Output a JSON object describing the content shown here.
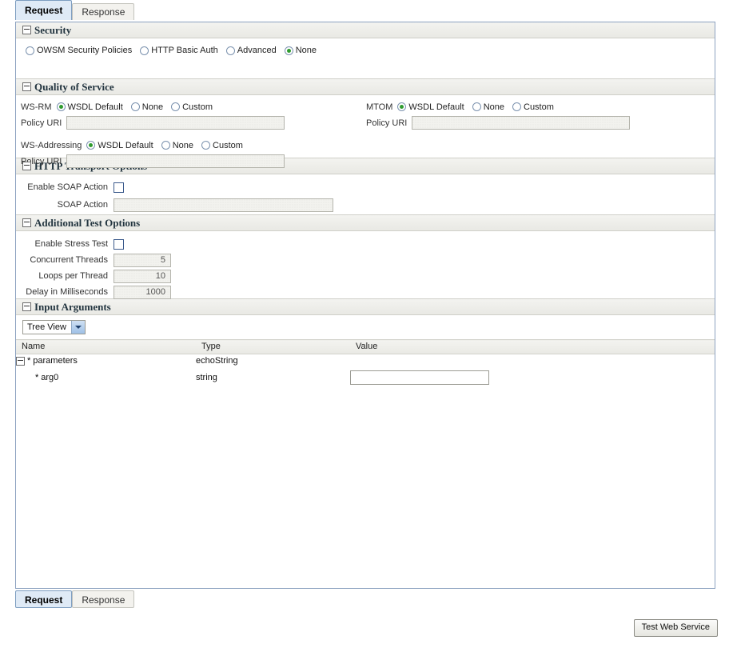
{
  "tabs_top": [
    {
      "label": "Request",
      "active": true
    },
    {
      "label": "Response",
      "active": false
    }
  ],
  "tabs_bottom": [
    {
      "label": "Request",
      "active": true
    },
    {
      "label": "Response",
      "active": false
    }
  ],
  "sections": {
    "security": {
      "title": "Security",
      "options": [
        {
          "label": "OWSM Security Policies",
          "selected": false
        },
        {
          "label": "HTTP Basic Auth",
          "selected": false
        },
        {
          "label": "Advanced",
          "selected": false
        },
        {
          "label": "None",
          "selected": true
        }
      ]
    },
    "qos": {
      "title": "Quality of Service",
      "wsrm": {
        "caption": "WS-RM",
        "options": [
          {
            "label": "WSDL Default",
            "selected": true
          },
          {
            "label": "None",
            "selected": false
          },
          {
            "label": "Custom",
            "selected": false
          }
        ],
        "policy_uri_label": "Policy URI",
        "policy_uri_value": "",
        "policy_uri_enabled": false
      },
      "mtom": {
        "caption": "MTOM",
        "options": [
          {
            "label": "WSDL Default",
            "selected": true
          },
          {
            "label": "None",
            "selected": false
          },
          {
            "label": "Custom",
            "selected": false
          }
        ],
        "policy_uri_label": "Policy URI",
        "policy_uri_value": "",
        "policy_uri_enabled": false
      },
      "wsaddressing": {
        "caption": "WS-Addressing",
        "options": [
          {
            "label": "WSDL Default",
            "selected": true
          },
          {
            "label": "None",
            "selected": false
          },
          {
            "label": "Custom",
            "selected": false
          }
        ],
        "policy_uri_label": "Policy URI",
        "policy_uri_value": "",
        "policy_uri_enabled": false
      }
    },
    "http_transport": {
      "title": "HTTP Transport Options",
      "enable_soap_action_label": "Enable SOAP Action",
      "enable_soap_action_checked": false,
      "soap_action_label": "SOAP Action",
      "soap_action_value": "",
      "soap_action_enabled": false
    },
    "additional_test": {
      "title": "Additional Test Options",
      "enable_stress_test_label": "Enable Stress Test",
      "enable_stress_test_checked": false,
      "fields": [
        {
          "label": "Concurrent Threads",
          "value": "5",
          "enabled": false
        },
        {
          "label": "Loops per Thread",
          "value": "10",
          "enabled": false
        },
        {
          "label": "Delay in Milliseconds",
          "value": "1000",
          "enabled": false
        }
      ]
    },
    "input_arguments": {
      "title": "Input Arguments",
      "view_select_value": "Tree View",
      "columns": [
        "Name",
        "Type",
        "Value"
      ],
      "rows": [
        {
          "name": "parameters",
          "required": true,
          "type": "echoString",
          "value": "",
          "has_input": false,
          "expandable": true,
          "level": 0
        },
        {
          "name": "arg0",
          "required": true,
          "type": "string",
          "value": "",
          "has_input": true,
          "expandable": false,
          "level": 1
        }
      ]
    }
  },
  "actions": {
    "test_web_service_label": "Test Web Service"
  },
  "colors": {
    "accent": "#dfeaf6",
    "radio_selected": "#2f9b2f",
    "border": "#8da2c0",
    "header_bg": "#eeeeea"
  }
}
